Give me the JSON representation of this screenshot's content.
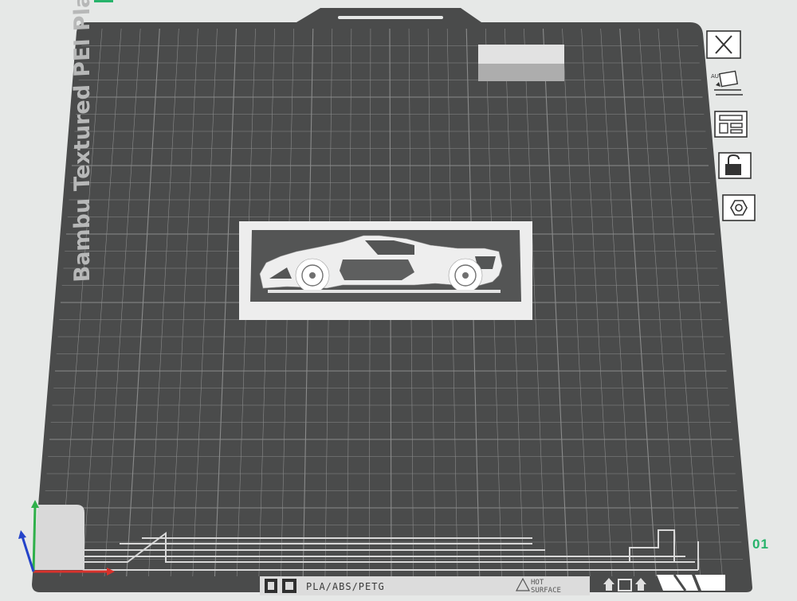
{
  "plate": {
    "name": "Bambu Textured PEI Plate",
    "number": "01",
    "label_strip": {
      "materials": "PLA/ABS/PETG",
      "warning_line1": "HOT",
      "warning_line2": "SURFACE"
    }
  },
  "toolbar": {
    "items": [
      {
        "name": "close-plate",
        "icon": "close-icon"
      },
      {
        "name": "auto-orient",
        "icon": "auto-orient-icon",
        "badge": "AUTO"
      },
      {
        "name": "arrange",
        "icon": "arrange-icon"
      },
      {
        "name": "lock-plate",
        "icon": "lock-icon"
      },
      {
        "name": "plate-settings",
        "icon": "hex-nut-icon"
      }
    ]
  },
  "model": {
    "name": "sports-car-silhouette-plaque"
  },
  "colors": {
    "background": "#e6e8e7",
    "plate": "#4a4b4b",
    "grid": "#8a8b8b",
    "model": "#ebebeb",
    "accent_green": "#27b36b",
    "axis_x": "#d9322c",
    "axis_y": "#2fb04a",
    "axis_z": "#2443c9"
  }
}
